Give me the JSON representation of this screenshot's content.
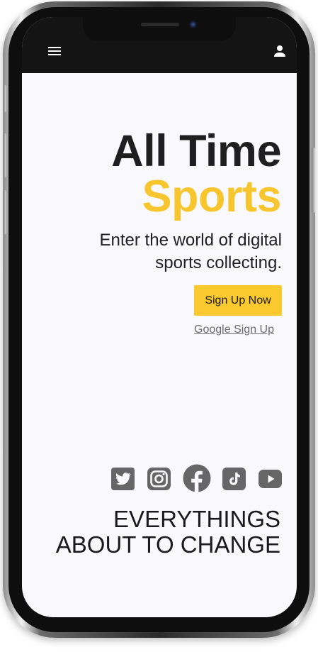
{
  "header": {
    "menu_icon": "hamburger-menu-icon",
    "profile_icon": "person-icon"
  },
  "hero": {
    "title_line1": "All Time",
    "title_line2": "Sports",
    "tagline": "Enter the world of digital sports collecting.",
    "signup_label": "Sign Up Now",
    "google_label": "Google Sign Up"
  },
  "social": [
    {
      "icon": "twitter-icon"
    },
    {
      "icon": "instagram-icon"
    },
    {
      "icon": "facebook-icon"
    },
    {
      "icon": "tiktok-icon"
    },
    {
      "icon": "youtube-icon"
    }
  ],
  "footer": {
    "line1": "EVERYTHINGS",
    "line2": "ABOUT TO CHANGE"
  },
  "colors": {
    "accent": "#f7c62f",
    "topbar": "#141414",
    "screen_bg": "#f9f9fb",
    "icon_gray": "#666666"
  }
}
